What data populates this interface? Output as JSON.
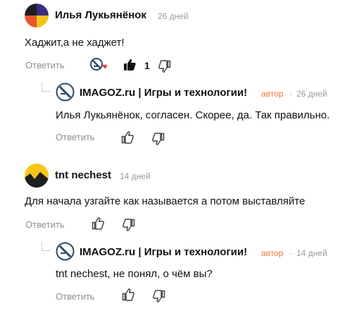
{
  "comments": [
    {
      "author": "Илья Лукьянёнок",
      "time": "26 дней",
      "text": "Хаджит,а не хаджет!",
      "reply_label": "Ответить",
      "likes": "1",
      "reply": {
        "author": "IMAGOZ.ru | Игры и технологии!",
        "badge": "автор",
        "dot": "·",
        "time": "26 дней",
        "text": "Илья Лукьянёнок, согласен. Скорее, да. Так правильно.",
        "reply_label": "Ответить"
      }
    },
    {
      "author": "tnt nechest",
      "time": "14 дней",
      "text": "Для начала узгайте как называется а потом выставляйте",
      "reply_label": "Ответить",
      "reply": {
        "author": "IMAGOZ.ru | Игры и технологии!",
        "badge": "автор",
        "dot": "·",
        "time": "14 дней",
        "text": "tnt nechest, не понял, о чём вы?",
        "reply_label": "Ответить"
      }
    }
  ],
  "colors": {
    "badge": "#f07a3a",
    "muted": "#8e8e8e",
    "like_heart": "#e8383d"
  }
}
